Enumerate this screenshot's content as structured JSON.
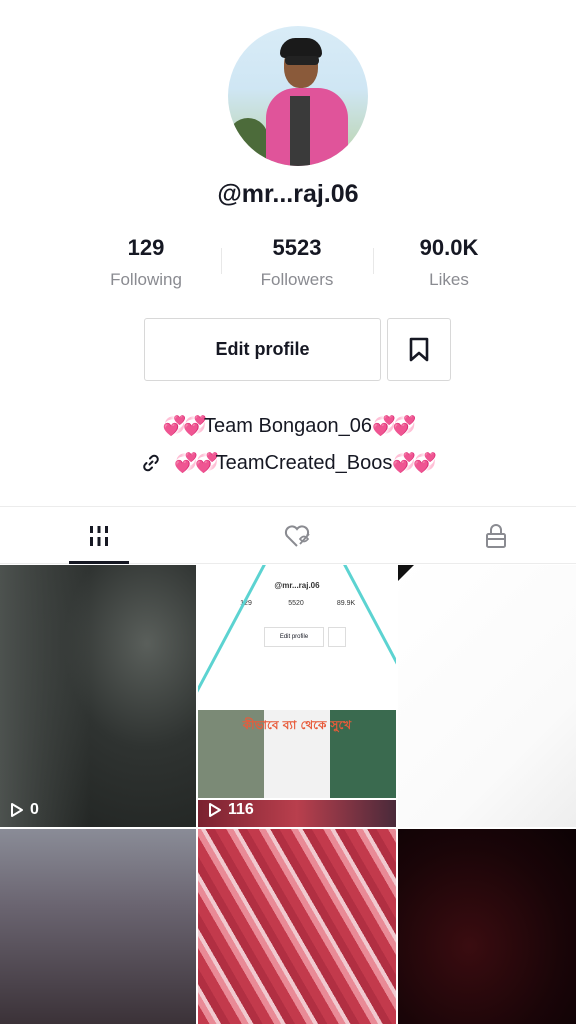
{
  "profile": {
    "username": "@mr...raj.06",
    "stats": [
      {
        "value": "129",
        "label": "Following"
      },
      {
        "value": "5523",
        "label": "Followers"
      },
      {
        "value": "90.0K",
        "label": "Likes"
      }
    ],
    "edit_button": "Edit profile",
    "bio_line1": "Team Bongaon_06",
    "bio_line2": "TeamCreated_Boos",
    "hearts": "💞💞"
  },
  "tabs": [
    {
      "name": "videos",
      "icon": "grid-bars-icon",
      "active": true
    },
    {
      "name": "liked",
      "icon": "heart-hidden-icon",
      "active": false
    },
    {
      "name": "private",
      "icon": "lock-icon",
      "active": false
    }
  ],
  "grid": {
    "items": [
      {
        "views": "0"
      },
      {
        "views": "116"
      },
      {
        "views": ""
      },
      {
        "views": ""
      },
      {
        "views": ""
      },
      {
        "views": ""
      }
    ],
    "mini_screenshot": {
      "username": "@mr...raj.06",
      "stats": [
        "129",
        "5520",
        "89.9K"
      ],
      "edit": "Edit profile",
      "bengali_caption": "কীভাবে ব্যা থেকে সুখে"
    }
  },
  "colors": {
    "text": "#161823",
    "muted": "#8a8b91",
    "border": "#d8d8d8",
    "hearts": "#ff3f9a"
  }
}
